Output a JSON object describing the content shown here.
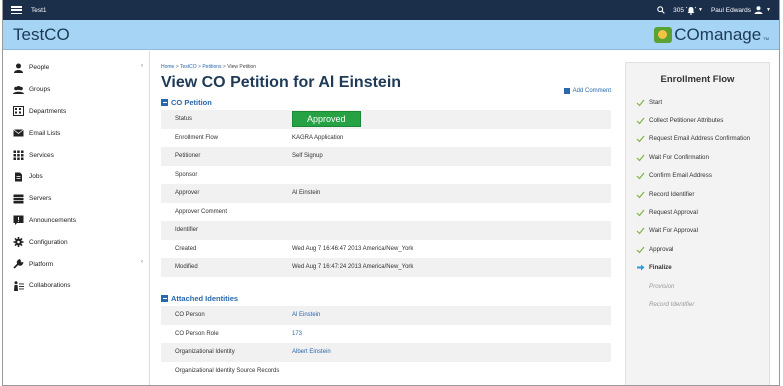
{
  "topbar": {
    "title": "Test1",
    "notification_count": "305",
    "user_name": "Paul Edwards"
  },
  "brand": {
    "name": "TestCO",
    "logo_text": "COmanage",
    "logo_tm": "TM"
  },
  "sidebar": {
    "items": [
      {
        "label": "People",
        "icon": "person-icon",
        "has_caret": true
      },
      {
        "label": "Groups",
        "icon": "groups-icon",
        "has_caret": false
      },
      {
        "label": "Departments",
        "icon": "building-icon",
        "has_caret": false
      },
      {
        "label": "Email Lists",
        "icon": "envelope-icon",
        "has_caret": false
      },
      {
        "label": "Services",
        "icon": "grid-icon",
        "has_caret": false
      },
      {
        "label": "Jobs",
        "icon": "document-icon",
        "has_caret": false
      },
      {
        "label": "Servers",
        "icon": "server-icon",
        "has_caret": false
      },
      {
        "label": "Announcements",
        "icon": "announcement-icon",
        "has_caret": false
      },
      {
        "label": "Configuration",
        "icon": "gear-icon",
        "has_caret": false
      },
      {
        "label": "Platform",
        "icon": "wrench-icon",
        "has_caret": true
      },
      {
        "label": "Collaborations",
        "icon": "collaborations-icon",
        "has_caret": false
      }
    ]
  },
  "main": {
    "breadcrumb": [
      "Home",
      "TestCO",
      "Petitions",
      "View Petition"
    ],
    "breadcrumb_sep": ">",
    "title": "View CO Petition for Al Einstein",
    "add_comment": "Add Comment",
    "petition_section": "CO Petition",
    "petition_rows": [
      {
        "label": "Status",
        "value": "Approved",
        "badge": true
      },
      {
        "label": "Enrollment Flow",
        "value": "KAGRA Application"
      },
      {
        "label": "Petitioner",
        "value": "Self Signup"
      },
      {
        "label": "Sponsor",
        "value": ""
      },
      {
        "label": "Approver",
        "value": "Al Einstein"
      },
      {
        "label": "Approver Comment",
        "value": ""
      },
      {
        "label": "Identifier",
        "value": ""
      },
      {
        "label": "Created",
        "value": "Wed Aug 7 16:46:47 2013 America/New_York"
      },
      {
        "label": "Modified",
        "value": "Wed Aug 7 16:47:24 2013 America/New_York"
      }
    ],
    "identities_section": "Attached Identities",
    "identity_rows": [
      {
        "label": "CO Person",
        "value": "Al Einstein",
        "link": true
      },
      {
        "label": "CO Person Role",
        "value": "173",
        "link": true
      },
      {
        "label": "Organizational Identity",
        "value": "Albert Einstein",
        "link": true
      },
      {
        "label": "Organizational Identity Source Records",
        "value": ""
      }
    ]
  },
  "flow": {
    "title": "Enrollment Flow",
    "steps": [
      {
        "label": "Start",
        "state": "done"
      },
      {
        "label": "Collect Petitioner Attributes",
        "state": "done"
      },
      {
        "label": "Request Email Address Confirmation",
        "state": "done"
      },
      {
        "label": "Wait For Confirmation",
        "state": "done"
      },
      {
        "label": "Confirm Email Address",
        "state": "done"
      },
      {
        "label": "Record Identifier",
        "state": "done"
      },
      {
        "label": "Request Approval",
        "state": "done"
      },
      {
        "label": "Wait For Approval",
        "state": "done"
      },
      {
        "label": "Approval",
        "state": "done"
      },
      {
        "label": "Finalize",
        "state": "current"
      },
      {
        "label": "Provision",
        "state": "pending"
      },
      {
        "label": "Record Identifier",
        "state": "pending"
      }
    ]
  },
  "colors": {
    "topbar": "#1b2e4a",
    "brandbar": "#a6d4f4",
    "link": "#2a68ad",
    "approved": "#26a244",
    "check": "#7fb441",
    "arrow": "#2a9ae0"
  }
}
